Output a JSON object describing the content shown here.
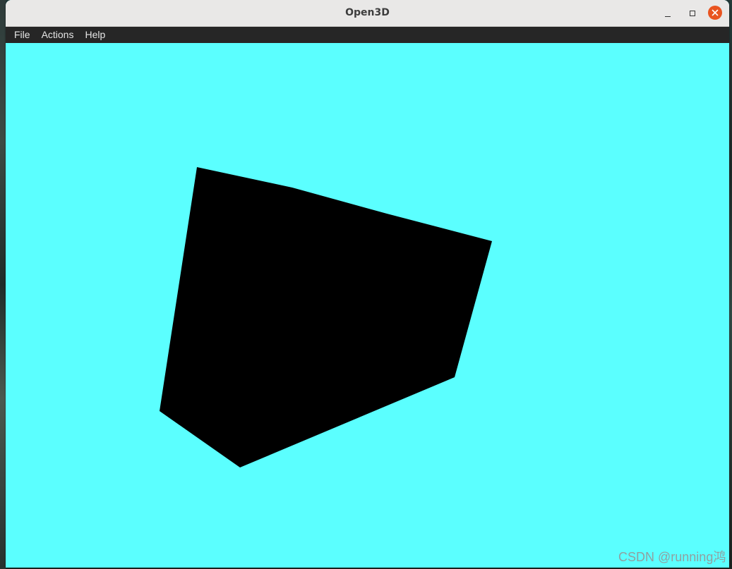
{
  "window": {
    "title": "Open3D"
  },
  "menu": {
    "items": [
      {
        "label": "File"
      },
      {
        "label": "Actions"
      },
      {
        "label": "Help"
      }
    ]
  },
  "scene": {
    "background_color": "#5bffff",
    "object_color": "#000000",
    "object": "cube"
  },
  "watermark": {
    "text": "CSDN @running鸿"
  },
  "colors": {
    "titlebar": "#e9e8e7",
    "menubar": "#262626",
    "close_button": "#e95420"
  }
}
